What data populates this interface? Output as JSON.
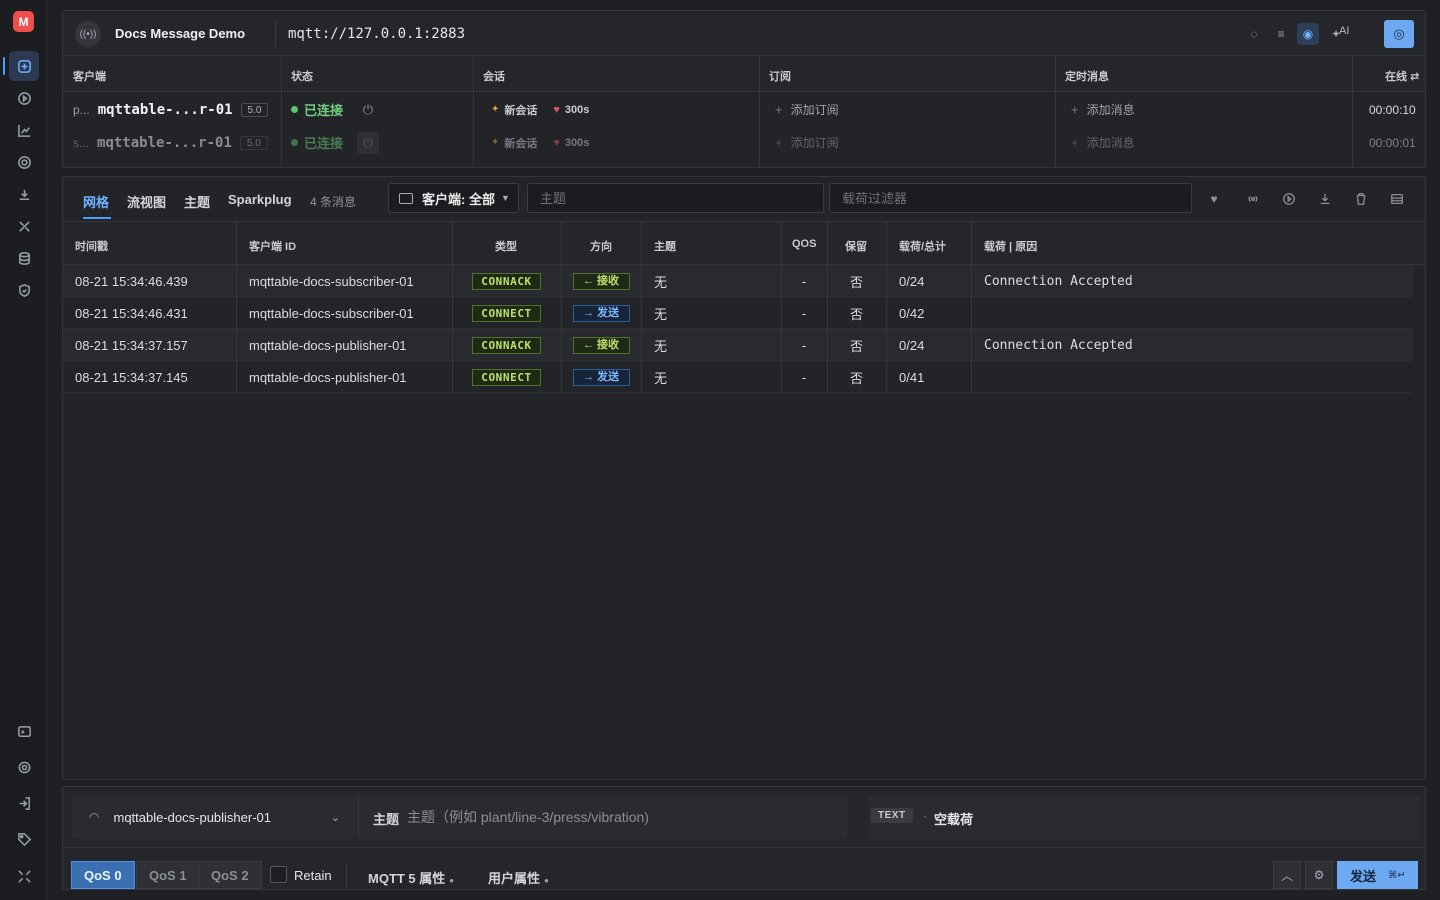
{
  "app": {
    "title": "Docs Message Demo",
    "url": "mqtt://127.0.0.1:2883",
    "ai_label": "AI",
    "logo_letter": "M"
  },
  "rail": {
    "icons": [
      "connections-icon",
      "play-icon",
      "chart-icon",
      "target-icon",
      "import-icon",
      "tools-icon",
      "database-icon",
      "shield-icon",
      "terminal-icon",
      "settings-icon",
      "login-icon",
      "tag-icon",
      "collapse-icon"
    ]
  },
  "clients_table": {
    "headers": {
      "client": "客户端",
      "status": "状态",
      "session": "会话",
      "subscribe": "订阅",
      "scheduled": "定时消息",
      "online": "在线"
    },
    "rows": [
      {
        "prefix": "p...",
        "name": "mqttable-...r-01",
        "version": "5.0",
        "status": "已连接",
        "session": "新会话",
        "expiry": "300s",
        "add_subscription": "添加订阅",
        "add_message": "添加消息",
        "online_time": "00:00:10"
      },
      {
        "prefix": "s...",
        "name": "mqttable-...r-01",
        "version": "5.0",
        "status": "已连接",
        "session": "新会话",
        "expiry": "300s",
        "add_subscription": "添加订阅",
        "add_message": "添加消息",
        "online_time": "00:00:01"
      }
    ]
  },
  "messages": {
    "tabs": [
      "网格",
      "流视图",
      "主题",
      "Sparkplug"
    ],
    "active_tab": "网格",
    "count_label": "4 条消息",
    "client_filter": "客户端: 全部",
    "topic_placeholder": "主题",
    "payload_placeholder": "载荷过滤器",
    "headers": {
      "timestamp": "时间戳",
      "client_id": "客户端 ID",
      "type": "类型",
      "direction": "方向",
      "topic": "主题",
      "qos": "QOS",
      "retain": "保留",
      "payload_total": "载荷/总计",
      "payload_reason": "载荷 | 原因"
    },
    "rows": [
      {
        "time": "08-21 15:34:46.439",
        "client": "mqttable-docs-subscriber-01",
        "type": "CONNACK",
        "dir": "← 接收",
        "dir_kind": "recv",
        "topic": "无",
        "qos": "-",
        "retain": "否",
        "size": "0/24",
        "payload": "Connection Accepted"
      },
      {
        "time": "08-21 15:34:46.431",
        "client": "mqttable-docs-subscriber-01",
        "type": "CONNECT",
        "dir": "→ 发送",
        "dir_kind": "send",
        "topic": "无",
        "qos": "-",
        "retain": "否",
        "size": "0/42",
        "payload": ""
      },
      {
        "time": "08-21 15:34:37.157",
        "client": "mqttable-docs-publisher-01",
        "type": "CONNACK",
        "dir": "← 接收",
        "dir_kind": "recv",
        "topic": "无",
        "qos": "-",
        "retain": "否",
        "size": "0/24",
        "payload": "Connection Accepted"
      },
      {
        "time": "08-21 15:34:37.145",
        "client": "mqttable-docs-publisher-01",
        "type": "CONNECT",
        "dir": "→ 发送",
        "dir_kind": "send",
        "topic": "无",
        "qos": "-",
        "retain": "否",
        "size": "0/41",
        "payload": ""
      }
    ]
  },
  "publish": {
    "client": "mqttable-docs-publisher-01",
    "topic_label": "主题",
    "topic_placeholder": "主题（例如 plant/line-3/press/vibration)",
    "format": "TEXT",
    "format_dot": "·",
    "payload_empty": "空载荷",
    "qos_options": [
      "QoS 0",
      "QoS 1",
      "QoS 2"
    ],
    "qos_selected": "QoS 0",
    "retain_label": "Retain",
    "mqtt5_props": "MQTT 5 属性",
    "user_props": "用户属性",
    "send_label": "发送",
    "send_shortcut": "⌘↵"
  },
  "colors": {
    "accent": "#4d9cff",
    "connected": "#5cc46e",
    "badge_green": "#b7e26a",
    "badge_blue": "#7fb8ff"
  }
}
